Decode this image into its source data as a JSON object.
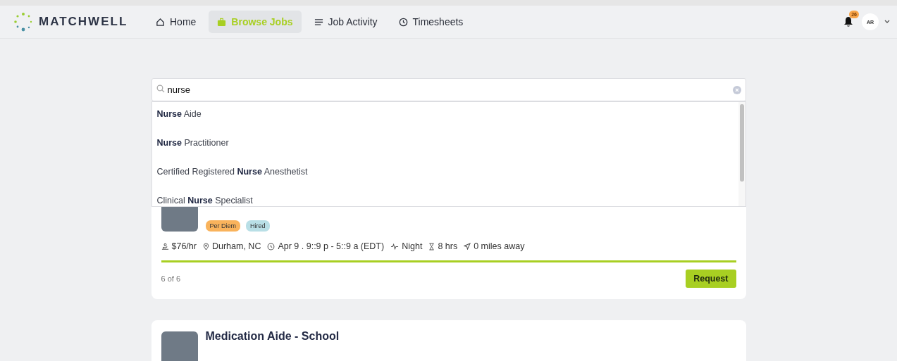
{
  "brand": "MATCHWELL",
  "nav": [
    {
      "label": "Home",
      "selected": false
    },
    {
      "label": "Browse Jobs",
      "selected": true
    },
    {
      "label": "Job Activity",
      "selected": false
    },
    {
      "label": "Timesheets",
      "selected": false
    }
  ],
  "notifications": {
    "count": "26"
  },
  "user": {
    "initials": "AR"
  },
  "search": {
    "value": "nurse"
  },
  "suggestions": [
    "**Nurse** Aide",
    "**Nurse** Practitioner",
    "Certified Registered **Nurse** Anesthetist",
    "Clinical **Nurse** Specialist"
  ],
  "cards": [
    {
      "tags": [
        {
          "label": "Per Diem",
          "color": "#f9b35c"
        },
        {
          "label": "Hired",
          "color": "#b9dfe6"
        }
      ],
      "meta": [
        {
          "kind": "pay",
          "text": "$76/hr"
        },
        {
          "kind": "location",
          "text": "Durham, NC"
        },
        {
          "kind": "time",
          "text": "Apr 9 . 9::9 p - 5::9 a (EDT)"
        },
        {
          "kind": "shift",
          "text": "Night"
        },
        {
          "kind": "duration",
          "text": "8 hrs"
        },
        {
          "kind": "distance",
          "text": "0 miles away"
        }
      ],
      "level": 1,
      "counter": "6 of 6",
      "action": "Request"
    },
    {
      "title": "Medication Aide - School"
    }
  ]
}
